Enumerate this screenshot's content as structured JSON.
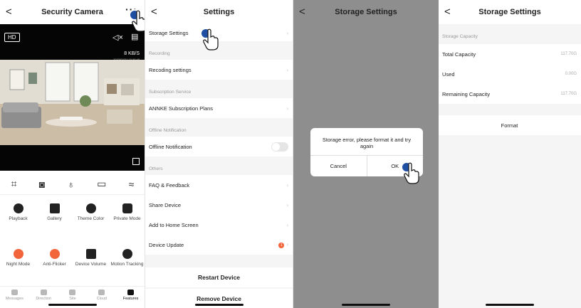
{
  "camera": {
    "back": "<",
    "title": "Security Camera",
    "more": "···",
    "hd": "HD",
    "speed": "8 KB/S",
    "timestamp": "2023/02/21   15:36:48",
    "tools": [
      "screenshot-frame-icon",
      "camera-icon",
      "mic-icon",
      "video-record-icon",
      "expand-chevron-icon"
    ],
    "features_row1": [
      {
        "label": "Playback",
        "color": "#222222"
      },
      {
        "label": "Gallery",
        "color": "#222222"
      },
      {
        "label": "Theme Color",
        "color": "#222222"
      },
      {
        "label": "Private Mode",
        "color": "#222222"
      }
    ],
    "features_row2": [
      {
        "label": "Night Mode",
        "color": "#f2643a"
      },
      {
        "label": "Anti-Flicker",
        "color": "#f2643a"
      },
      {
        "label": "Device Volume",
        "color": "#222222"
      },
      {
        "label": "Motion Tracking",
        "color": "#222222"
      }
    ],
    "tabs": [
      "Messages",
      "Direction",
      "Site",
      "Cloud",
      "Features"
    ],
    "active_tab": "Features"
  },
  "settings": {
    "back": "<",
    "title": "Settings",
    "storage_settings": "Storage Settings",
    "section_recording": "Recording",
    "recording_settings": "Recoding settings",
    "section_subscription": "Subscription Service",
    "subscription_plans": "ANNKE Subscription Plans",
    "section_offline": "Offline Notification",
    "offline_notification": "Offline Notification",
    "section_others": "Others",
    "faq": "FAQ & Feedback",
    "share_device": "Share Device",
    "add_home": "Add to Home Screen",
    "device_update": "Device Update",
    "update_badge": "1",
    "restart": "Restart Device",
    "remove": "Remove Device"
  },
  "dialog_screen": {
    "back": "<",
    "title": "Storage Settings",
    "message": "Storage error, please format it and try again",
    "cancel": "Cancel",
    "ok": "OK"
  },
  "storage": {
    "back": "<",
    "title": "Storage Settings",
    "section_capacity": "Storage Capacity",
    "total_label": "Total Capacity",
    "total_value": "117.70G",
    "used_label": "Used",
    "used_value": "0.00G",
    "remaining_label": "Remaining Capacity",
    "remaining_value": "117.70G",
    "format": "Format"
  },
  "colors": {
    "accent_orange": "#f2643a",
    "tap_indicator": "#1e4fa3",
    "dim_overlay": "#8e8e8e"
  }
}
